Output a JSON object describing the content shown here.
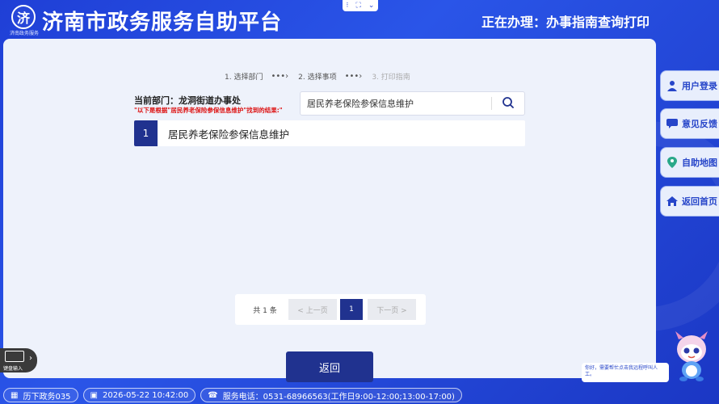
{
  "header": {
    "logo_text": "济",
    "logo_sub": "济南政务服务",
    "title": "济南市政务服务自助平台",
    "current_task": "正在办理：办事指南查询打印"
  },
  "steps": [
    {
      "label": "1. 选择部门"
    },
    {
      "label": "2. 选择事项"
    },
    {
      "label": "3. 打印指南"
    }
  ],
  "department": {
    "line": "当前部门：龙洞街道办事处",
    "hint": "\"以下是根据\"居民养老保险参保信息维护\"找到的结果:\""
  },
  "search": {
    "value": "居民养老保险参保信息维护"
  },
  "results": [
    {
      "index": "1",
      "name": "居民养老保险参保信息维护"
    }
  ],
  "pager": {
    "total": "共 1 条",
    "prev": "< 上一页",
    "current": "1",
    "next": "下一页 >"
  },
  "back_label": "返回",
  "sidebar": [
    {
      "label": "用户登录",
      "icon": "user-icon"
    },
    {
      "label": "意见反馈",
      "icon": "feedback-icon"
    },
    {
      "label": "自助地图",
      "icon": "map-icon"
    },
    {
      "label": "返回首页",
      "icon": "home-icon"
    }
  ],
  "keyboard_label": "键盘输入",
  "assistant_text": "你好，需要帮忙点击我远程呼叫人工。",
  "status": {
    "terminal": "历下政务035",
    "datetime": "2026-05-22 10:42:00",
    "phone": "服务电话：0531-68966563(工作日9:00-12:00;13:00-17:00)"
  },
  "colors": {
    "brand_blue": "#2747d9",
    "navy": "#20328f",
    "hint_red": "#dd1111"
  }
}
